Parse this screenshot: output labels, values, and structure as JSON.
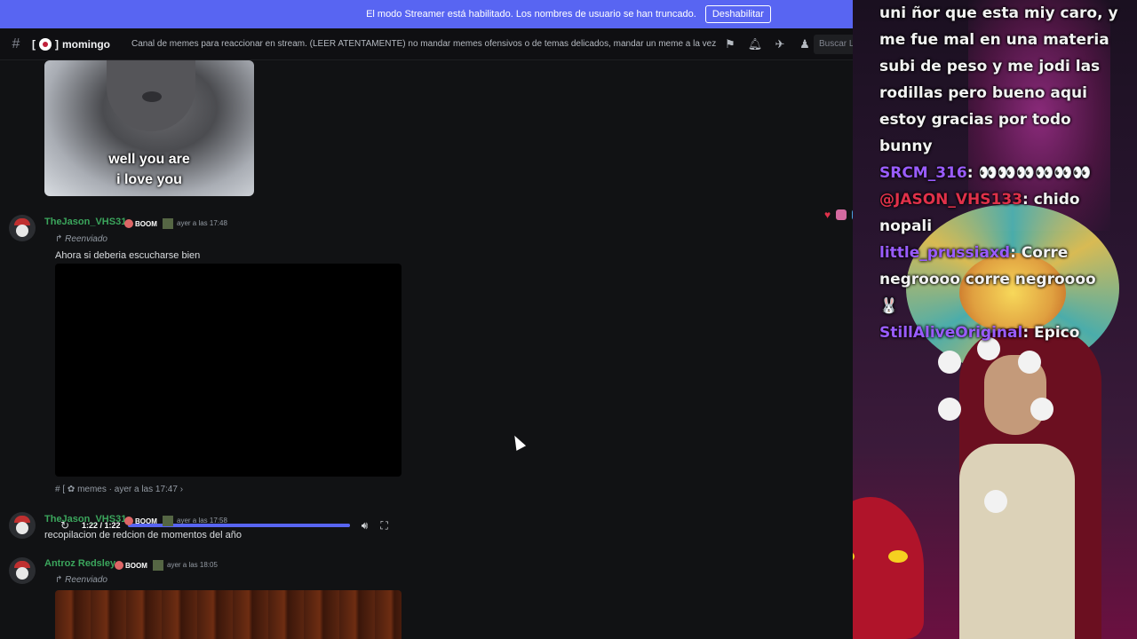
{
  "banner": {
    "text": "El modo Streamer está habilitado. Los nombres de usuario se han truncado.",
    "button": "Deshabilitar"
  },
  "header": {
    "channel": "momingo",
    "channel_prefix": "[",
    "channel_suffix": "]",
    "topic": "Canal de memes para reaccionar en stream. (LEER ATENTAMENTE) no mandar memes ofensivos o de temas delicados, mandar un meme a la vez , ver qu...",
    "search_placeholder": "Buscar Little Hell House",
    "icons": [
      "threads-icon",
      "bell-icon",
      "pin-icon",
      "members-icon"
    ]
  },
  "gif": {
    "caption_line1": "well you are",
    "caption_line2": "i love you"
  },
  "messages": [
    {
      "user": "TheJason_VHS31",
      "tag": "BOOM",
      "time": "ayer a las 17:48",
      "forwarded": "Reenviado",
      "text": "Ahora si deberia escucharse bien",
      "video_time": "1:22 / 1:22",
      "video_progress": 1.0,
      "source_hash": "#",
      "source_bracket": "[",
      "source_channel": "memes",
      "source_time": "ayer a las 17:47"
    },
    {
      "user": "TheJason_VHS31",
      "tag": "BOOM",
      "time": "ayer a las 17:58",
      "text": "recopilacion de redcion de momentos del año"
    },
    {
      "user": "Antroz Redsley",
      "tag": "BOOM",
      "time": "ayer a las 18:05",
      "forwarded": "Reenviado"
    }
  ],
  "stream_chat": [
    {
      "user": "",
      "text": "uni ñor que esta miy caro, y"
    },
    {
      "user": "",
      "text": "me fue mal en una materia"
    },
    {
      "user": "",
      "text": "subi de peso y me jodi las"
    },
    {
      "user": "",
      "text": "rodillas pero bueno aqui"
    },
    {
      "user": "",
      "text": "estoy gracias por todo"
    },
    {
      "user": "",
      "text": "bunny"
    },
    {
      "user": "SRCM_316",
      "text": ": "
    },
    {
      "user": "@JASON_VHS133",
      "text": ": chido"
    },
    {
      "user": "",
      "text": "nopali"
    },
    {
      "user": "little_prussiaxd",
      "text": ": Corre"
    },
    {
      "user": "",
      "text": "negroooo corre negroooo"
    },
    {
      "user": "",
      "text": ""
    },
    {
      "user": "StillAliveOriginal",
      "text": ": Epico"
    }
  ],
  "colors": {
    "accent": "#5865f2",
    "username_green": "#3ba55c",
    "chat_user_purple": "#9a5cff",
    "chat_user_red": "#e0314a"
  }
}
